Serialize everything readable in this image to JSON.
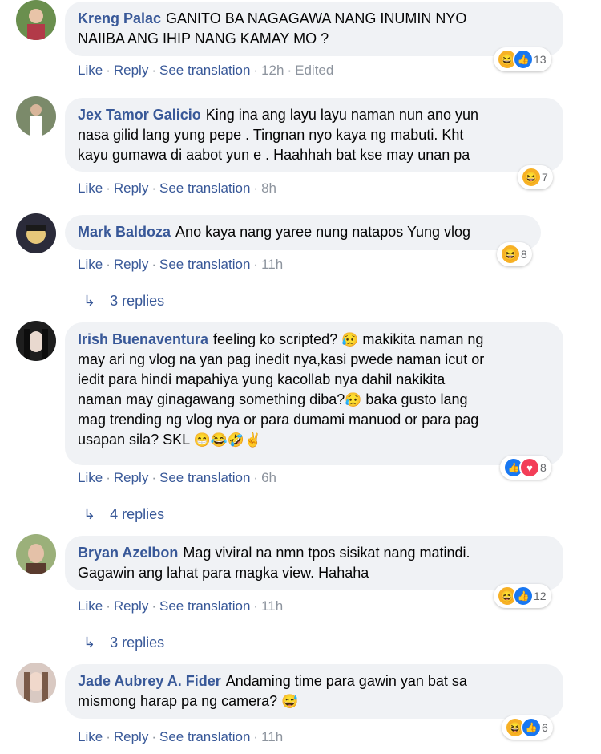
{
  "comments": [
    {
      "name": "Kreng Palac",
      "text": "GANITO BA NAGAGAWA NANG INUMIN NYO NAIIBA ANG IHIP NANG KAMAY MO ?",
      "text_line1": "GANITO BA NAGAGAWA NANG INUMIN NYO",
      "text_line2": "NAIIBA ANG IHIP NANG KAMAY MO ?",
      "like": "Like",
      "reply": "Reply",
      "see_translation": "See translation",
      "time": "12h",
      "edited": "Edited",
      "reactions": [
        "haha-icon",
        "like-icon"
      ],
      "reaction_count": "13"
    },
    {
      "name": "Jex Tamor Galicio",
      "text_line1": "King ina ang layu layu naman nun ano yun",
      "text_line2": "nasa gilid lang yung pepe . Tingnan nyo kaya ng mabuti. Kht",
      "text_line3": "kayu gumawa di aabot yun e . Haahhah bat kse may unan pa",
      "like": "Like",
      "reply": "Reply",
      "see_translation": "See translation",
      "time": "8h",
      "reactions": [
        "haha-icon"
      ],
      "reaction_count": "7"
    },
    {
      "name": "Mark Baldoza",
      "text": "Ano kaya nang yaree nung natapos Yung vlog",
      "like": "Like",
      "reply": "Reply",
      "see_translation": "See translation",
      "time": "11h",
      "reactions": [
        "haha-icon"
      ],
      "reaction_count": "8",
      "replies": "3 replies"
    },
    {
      "name": "Irish Buenaventura",
      "text_line1": "feeling ko scripted?",
      "text_line1b": "makikita naman ng",
      "text_line2": "may ari ng vlog na yan pag inedit nya,kasi pwede naman icut or",
      "text_line3": "iedit para hindi mapahiya yung kacollab nya dahil nakikita",
      "text_line4": "naman may ginagawang something diba?",
      "text_line4b": "baka gusto lang",
      "text_line5": "mag trending ng vlog nya or para dumami manuod or para pag",
      "text_line6": "usapan sila? SKL",
      "emoji_confused": "😥",
      "emoji_end": "😁😂🤣✌",
      "like": "Like",
      "reply": "Reply",
      "see_translation": "See translation",
      "time": "6h",
      "reactions": [
        "like-icon",
        "love-icon"
      ],
      "reaction_count": "8",
      "replies": "4 replies"
    },
    {
      "name": "Bryan Azelbon",
      "text_line1": "Mag viviral na nmn tpos sisikat nang matindi.",
      "text_line2": "Gagawin ang lahat para magka view. Hahaha",
      "like": "Like",
      "reply": "Reply",
      "see_translation": "See translation",
      "time": "11h",
      "reactions": [
        "haha-icon",
        "like-icon"
      ],
      "reaction_count": "12",
      "replies": "3 replies"
    },
    {
      "name": "Jade Aubrey A. Fider",
      "text_line1": "Andaming time para gawin yan bat sa",
      "text_line2": "mismong harap pa ng camera?",
      "emoji_end": "😅",
      "like": "Like",
      "reply": "Reply",
      "see_translation": "See translation",
      "time": "11h",
      "reactions": [
        "haha-icon",
        "like-icon"
      ],
      "reaction_count": "6"
    }
  ],
  "colors": {
    "link": "#385898",
    "bubble": "#f0f2f5",
    "meta": "#8d949e",
    "like_blue": "#1877f2",
    "love_red": "#f33e58",
    "haha_yellow": "#f7b125"
  }
}
